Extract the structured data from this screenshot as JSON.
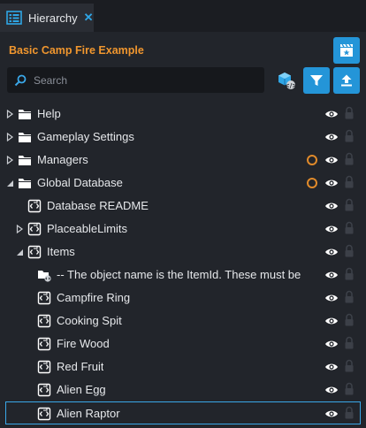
{
  "tab": {
    "title": "Hierarchy"
  },
  "panel": {
    "project_title": "Basic Camp Fire Example"
  },
  "search": {
    "placeholder": "Search",
    "value": ""
  },
  "colors": {
    "accent": "#2495d8",
    "orange": "#f0962e",
    "selection": "#3aa7e8"
  },
  "tree": [
    {
      "label": "Help",
      "icon": "folder-icon",
      "expander": "collapsed"
    },
    {
      "label": "Gameplay Settings",
      "icon": "folder-icon",
      "expander": "collapsed"
    },
    {
      "label": "Managers",
      "icon": "folder-icon",
      "expander": "collapsed",
      "modified": true
    },
    {
      "label": "Global Database",
      "icon": "folder-icon",
      "expander": "expanded",
      "modified": true
    },
    {
      "label": "Database README",
      "icon": "script-icon",
      "expander": "none"
    },
    {
      "label": "PlaceableLimits",
      "icon": "script-icon",
      "expander": "collapsed"
    },
    {
      "label": "Items",
      "icon": "script-icon",
      "expander": "expanded"
    },
    {
      "label": "-- The object name is the ItemId. These must be u",
      "icon": "script-folder-icon",
      "expander": "none"
    },
    {
      "label": "Campfire Ring",
      "icon": "script-icon",
      "expander": "none"
    },
    {
      "label": "Cooking Spit",
      "icon": "script-icon",
      "expander": "none"
    },
    {
      "label": "Fire Wood",
      "icon": "script-icon",
      "expander": "none"
    },
    {
      "label": "Red Fruit",
      "icon": "script-icon",
      "expander": "none"
    },
    {
      "label": "Alien Egg",
      "icon": "script-icon",
      "expander": "none"
    },
    {
      "label": "Alien Raptor",
      "icon": "script-icon",
      "expander": "none",
      "selected": true
    }
  ]
}
